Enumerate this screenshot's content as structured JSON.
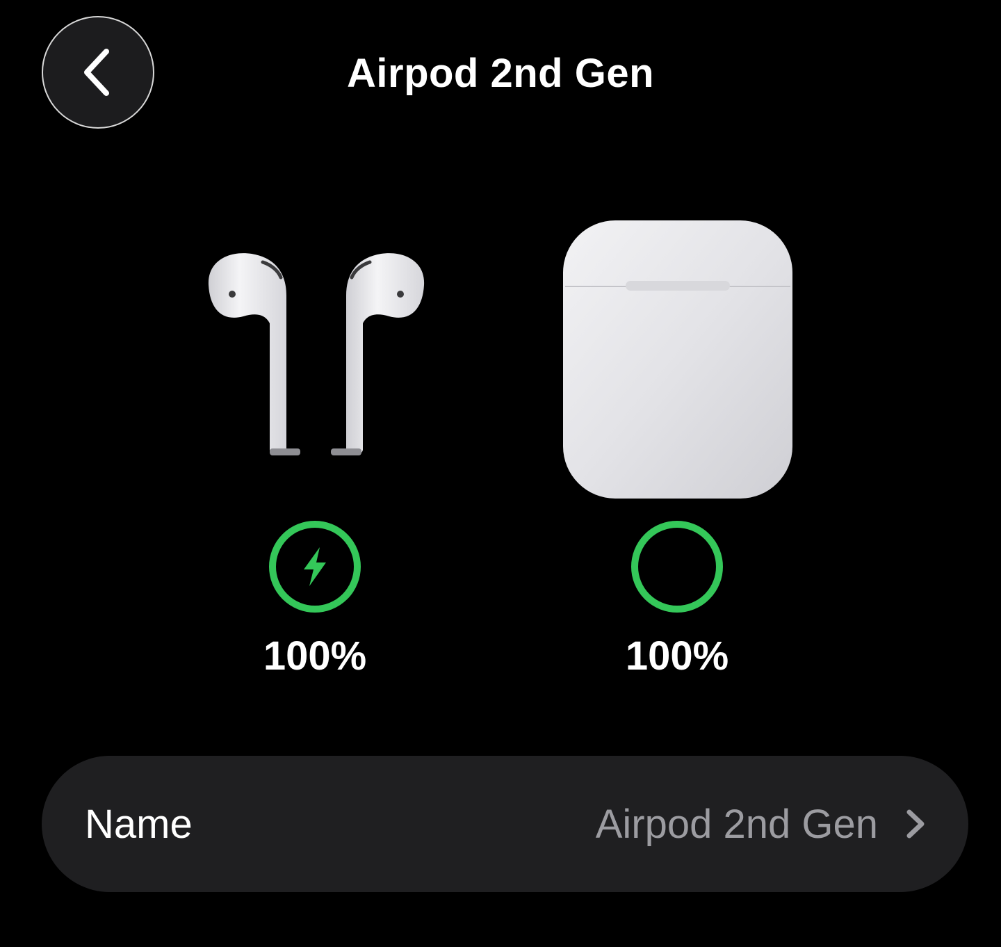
{
  "header": {
    "title": "Airpod 2nd Gen",
    "back_icon": "chevron-left-icon"
  },
  "devices": {
    "buds": {
      "battery": "100%",
      "battery_level": 1.0,
      "charging": true,
      "status_icon": "bolt-icon",
      "ring_color": "#34c759"
    },
    "case": {
      "battery": "100%",
      "battery_level": 1.0,
      "charging": false,
      "ring_color": "#34c759"
    }
  },
  "settings": {
    "name_row": {
      "label": "Name",
      "value": "Airpod 2nd Gen",
      "chevron_icon": "chevron-right-icon"
    }
  }
}
